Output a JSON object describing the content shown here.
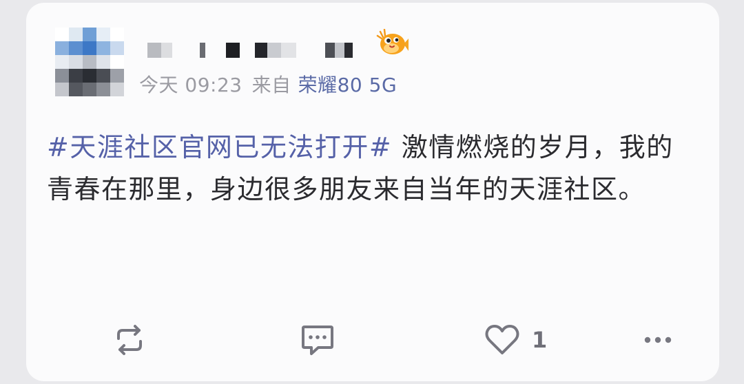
{
  "post": {
    "avatar_pixels": [
      [
        "#ffffff",
        "#dfe9f2",
        "#6f9fd6",
        "#e6eef6",
        "#ffffff"
      ],
      [
        "#8ab0de",
        "#5c8fd0",
        "#3d78c6",
        "#8eb4e0",
        "#c9d9ee"
      ],
      [
        "#e8ecf2",
        "#d9dde4",
        "#b8bcc4",
        "#dfe3ea",
        "#ffffff"
      ],
      [
        "#8b8f98",
        "#3b3e45",
        "#2a2d33",
        "#4a4d54",
        "#9da0a8"
      ],
      [
        "#c4c6cc",
        "#55585f",
        "#6a6d74",
        "#8c8f96",
        "#d2d4d9"
      ]
    ],
    "username_blocks": [
      {
        "w": 20,
        "c": "#b9bbc0"
      },
      {
        "w": 16,
        "c": "#dcdde0"
      },
      {
        "w": 40,
        "c": "#fbfbfc"
      },
      {
        "w": 8,
        "c": "#6a6c72"
      },
      {
        "w": 30,
        "c": "#fbfbfc"
      },
      {
        "w": 20,
        "c": "#1e1f23"
      },
      {
        "w": 22,
        "c": "#fbfbfc"
      },
      {
        "w": 18,
        "c": "#24252a"
      },
      {
        "w": 20,
        "c": "#c9cbd0"
      },
      {
        "w": 22,
        "c": "#e2e3e6"
      },
      {
        "w": 42,
        "c": "#fbfbfc"
      },
      {
        "w": 14,
        "c": "#4d4f55"
      },
      {
        "w": 14,
        "c": "#c2c4c9"
      },
      {
        "w": 12,
        "c": "#2a2b30"
      }
    ],
    "time": "今天 09:23",
    "from_label": "来自",
    "source": "荣耀80 5G",
    "topic": "#天涯社区官网已无法打开#",
    "body": " 激情燃烧的岁月，我的青春在那里，身边很多朋友来自当年的天涯社区。",
    "like_count": "1"
  },
  "icons": {
    "badge": "pufferfish-badge-icon",
    "repost": "repost-icon",
    "comment": "comment-icon",
    "like": "heart-icon",
    "more": "more-dots-icon"
  },
  "colors": {
    "topic": "#5561a8",
    "source": "#5a6aa6",
    "text": "#2b2b2f",
    "meta": "#9b9ba2",
    "icon": "#777780"
  }
}
